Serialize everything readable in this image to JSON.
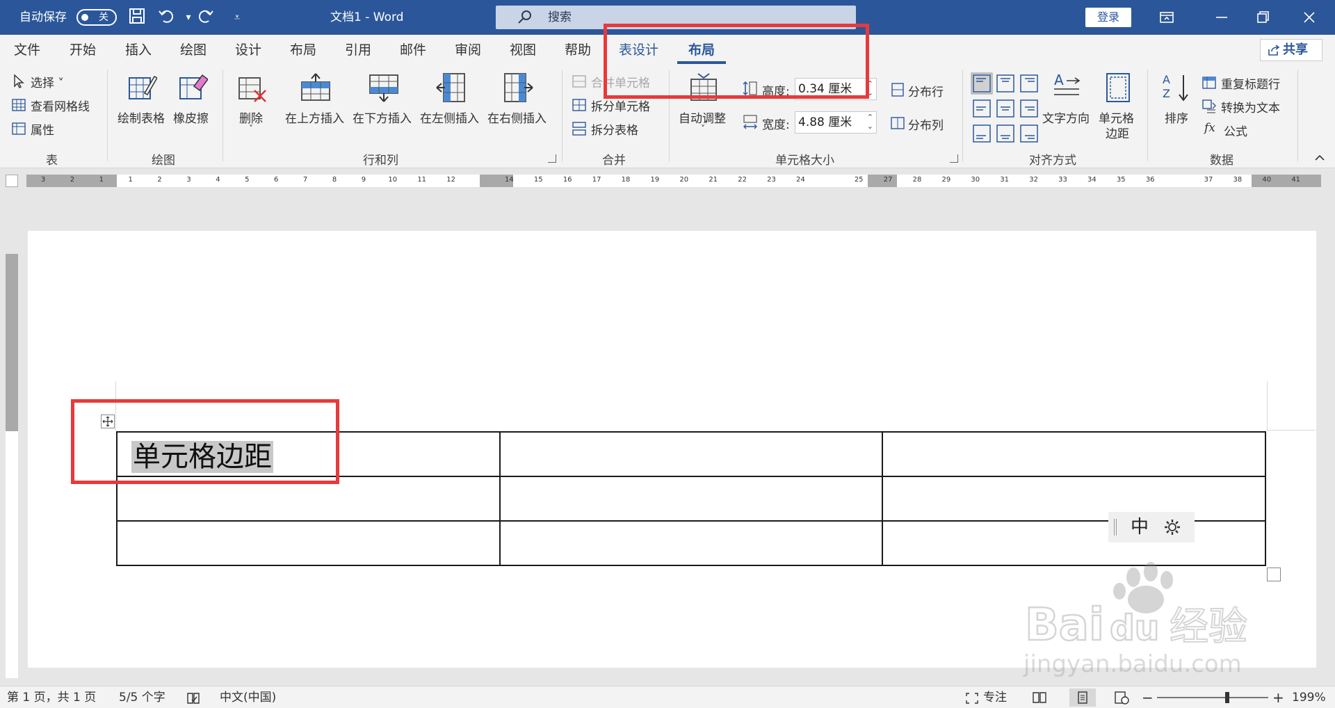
{
  "titlebar": {
    "autosave_label": "自动保存",
    "autosave_state": "关",
    "doc_title": "文档1  -  Word",
    "search_placeholder": "搜索",
    "login_label": "登录"
  },
  "tabs": [
    "文件",
    "开始",
    "插入",
    "绘图",
    "设计",
    "布局",
    "引用",
    "邮件",
    "审阅",
    "视图",
    "帮助",
    "表设计",
    "布局"
  ],
  "share_label": "共享",
  "ribbon": {
    "table_group": {
      "label": "表",
      "select": "选择",
      "view_gridlines": "查看网格线",
      "properties": "属性"
    },
    "draw_group": {
      "label": "绘图",
      "draw_table": "绘制表格",
      "eraser": "橡皮擦"
    },
    "rows_cols_group": {
      "label": "行和列",
      "delete": "删除",
      "insert_above": "在上方插入",
      "insert_below": "在下方插入",
      "insert_left": "在左侧插入",
      "insert_right": "在右侧插入"
    },
    "merge_group": {
      "label": "合并",
      "merge_cells": "合并单元格",
      "split_cells": "拆分单元格",
      "split_table": "拆分表格"
    },
    "cell_size_group": {
      "label": "单元格大小",
      "autofit": "自动调整",
      "height_label": "高度:",
      "height_value": "0.34 厘米",
      "width_label": "宽度:",
      "width_value": "4.88 厘米",
      "distribute_rows": "分布行",
      "distribute_cols": "分布列"
    },
    "alignment_group": {
      "label": "对齐方式",
      "text_direction": "文字方向",
      "cell_margins_1": "单元格",
      "cell_margins_2": "边距"
    },
    "data_group": {
      "label": "数据",
      "sort": "排序",
      "repeat_header": "重复标题行",
      "convert_to_text": "转换为文本",
      "formula": "公式"
    }
  },
  "ruler_numbers": [
    "3",
    "2",
    "1",
    "1",
    "2",
    "3",
    "4",
    "5",
    "6",
    "7",
    "8",
    "9",
    "10",
    "11",
    "12",
    "14",
    "15",
    "16",
    "17",
    "18",
    "19",
    "20",
    "21",
    "22",
    "23",
    "24",
    "25",
    "27",
    "28",
    "29",
    "30",
    "31",
    "32",
    "33",
    "34",
    "35",
    "36",
    "37",
    "38",
    "40",
    "41"
  ],
  "document": {
    "cell_text": "单元格边距",
    "rows": 3,
    "cols": 3
  },
  "ime": {
    "mode": "中"
  },
  "watermark": {
    "brand": "Bai du 经验",
    "url": "jingyan.baidu.com"
  },
  "status": {
    "page": "第 1 页，共 1 页",
    "words": "5/5 个字",
    "language": "中文(中国)",
    "focus": "专注",
    "zoom": "199%"
  },
  "colors": {
    "title_blue": "#2b579a",
    "highlight_red": "#e8393b"
  }
}
